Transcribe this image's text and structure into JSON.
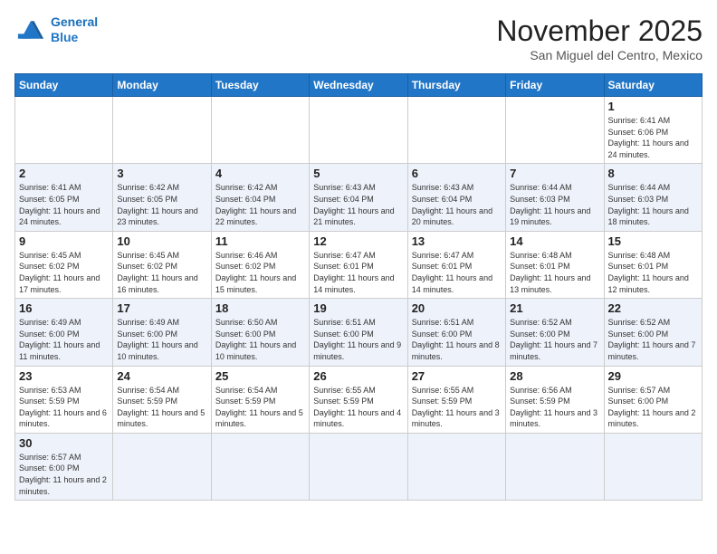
{
  "logo": {
    "line1": "General",
    "line2": "Blue"
  },
  "title": "November 2025",
  "location": "San Miguel del Centro, Mexico",
  "days_of_week": [
    "Sunday",
    "Monday",
    "Tuesday",
    "Wednesday",
    "Thursday",
    "Friday",
    "Saturday"
  ],
  "weeks": [
    [
      {
        "day": "",
        "info": ""
      },
      {
        "day": "",
        "info": ""
      },
      {
        "day": "",
        "info": ""
      },
      {
        "day": "",
        "info": ""
      },
      {
        "day": "",
        "info": ""
      },
      {
        "day": "",
        "info": ""
      },
      {
        "day": "1",
        "info": "Sunrise: 6:41 AM\nSunset: 6:06 PM\nDaylight: 11 hours\nand 24 minutes."
      }
    ],
    [
      {
        "day": "2",
        "info": "Sunrise: 6:41 AM\nSunset: 6:05 PM\nDaylight: 11 hours\nand 24 minutes."
      },
      {
        "day": "3",
        "info": "Sunrise: 6:42 AM\nSunset: 6:05 PM\nDaylight: 11 hours\nand 23 minutes."
      },
      {
        "day": "4",
        "info": "Sunrise: 6:42 AM\nSunset: 6:04 PM\nDaylight: 11 hours\nand 22 minutes."
      },
      {
        "day": "5",
        "info": "Sunrise: 6:43 AM\nSunset: 6:04 PM\nDaylight: 11 hours\nand 21 minutes."
      },
      {
        "day": "6",
        "info": "Sunrise: 6:43 AM\nSunset: 6:04 PM\nDaylight: 11 hours\nand 20 minutes."
      },
      {
        "day": "7",
        "info": "Sunrise: 6:44 AM\nSunset: 6:03 PM\nDaylight: 11 hours\nand 19 minutes."
      },
      {
        "day": "8",
        "info": "Sunrise: 6:44 AM\nSunset: 6:03 PM\nDaylight: 11 hours\nand 18 minutes."
      }
    ],
    [
      {
        "day": "9",
        "info": "Sunrise: 6:45 AM\nSunset: 6:02 PM\nDaylight: 11 hours\nand 17 minutes."
      },
      {
        "day": "10",
        "info": "Sunrise: 6:45 AM\nSunset: 6:02 PM\nDaylight: 11 hours\nand 16 minutes."
      },
      {
        "day": "11",
        "info": "Sunrise: 6:46 AM\nSunset: 6:02 PM\nDaylight: 11 hours\nand 15 minutes."
      },
      {
        "day": "12",
        "info": "Sunrise: 6:47 AM\nSunset: 6:01 PM\nDaylight: 11 hours\nand 14 minutes."
      },
      {
        "day": "13",
        "info": "Sunrise: 6:47 AM\nSunset: 6:01 PM\nDaylight: 11 hours\nand 14 minutes."
      },
      {
        "day": "14",
        "info": "Sunrise: 6:48 AM\nSunset: 6:01 PM\nDaylight: 11 hours\nand 13 minutes."
      },
      {
        "day": "15",
        "info": "Sunrise: 6:48 AM\nSunset: 6:01 PM\nDaylight: 11 hours\nand 12 minutes."
      }
    ],
    [
      {
        "day": "16",
        "info": "Sunrise: 6:49 AM\nSunset: 6:00 PM\nDaylight: 11 hours\nand 11 minutes."
      },
      {
        "day": "17",
        "info": "Sunrise: 6:49 AM\nSunset: 6:00 PM\nDaylight: 11 hours\nand 10 minutes."
      },
      {
        "day": "18",
        "info": "Sunrise: 6:50 AM\nSunset: 6:00 PM\nDaylight: 11 hours\nand 10 minutes."
      },
      {
        "day": "19",
        "info": "Sunrise: 6:51 AM\nSunset: 6:00 PM\nDaylight: 11 hours\nand 9 minutes."
      },
      {
        "day": "20",
        "info": "Sunrise: 6:51 AM\nSunset: 6:00 PM\nDaylight: 11 hours\nand 8 minutes."
      },
      {
        "day": "21",
        "info": "Sunrise: 6:52 AM\nSunset: 6:00 PM\nDaylight: 11 hours\nand 7 minutes."
      },
      {
        "day": "22",
        "info": "Sunrise: 6:52 AM\nSunset: 6:00 PM\nDaylight: 11 hours\nand 7 minutes."
      }
    ],
    [
      {
        "day": "23",
        "info": "Sunrise: 6:53 AM\nSunset: 5:59 PM\nDaylight: 11 hours\nand 6 minutes."
      },
      {
        "day": "24",
        "info": "Sunrise: 6:54 AM\nSunset: 5:59 PM\nDaylight: 11 hours\nand 5 minutes."
      },
      {
        "day": "25",
        "info": "Sunrise: 6:54 AM\nSunset: 5:59 PM\nDaylight: 11 hours\nand 5 minutes."
      },
      {
        "day": "26",
        "info": "Sunrise: 6:55 AM\nSunset: 5:59 PM\nDaylight: 11 hours\nand 4 minutes."
      },
      {
        "day": "27",
        "info": "Sunrise: 6:55 AM\nSunset: 5:59 PM\nDaylight: 11 hours\nand 3 minutes."
      },
      {
        "day": "28",
        "info": "Sunrise: 6:56 AM\nSunset: 5:59 PM\nDaylight: 11 hours\nand 3 minutes."
      },
      {
        "day": "29",
        "info": "Sunrise: 6:57 AM\nSunset: 6:00 PM\nDaylight: 11 hours\nand 2 minutes."
      }
    ],
    [
      {
        "day": "30",
        "info": "Sunrise: 6:57 AM\nSunset: 6:00 PM\nDaylight: 11 hours\nand 2 minutes."
      },
      {
        "day": "",
        "info": ""
      },
      {
        "day": "",
        "info": ""
      },
      {
        "day": "",
        "info": ""
      },
      {
        "day": "",
        "info": ""
      },
      {
        "day": "",
        "info": ""
      },
      {
        "day": "",
        "info": ""
      }
    ]
  ]
}
